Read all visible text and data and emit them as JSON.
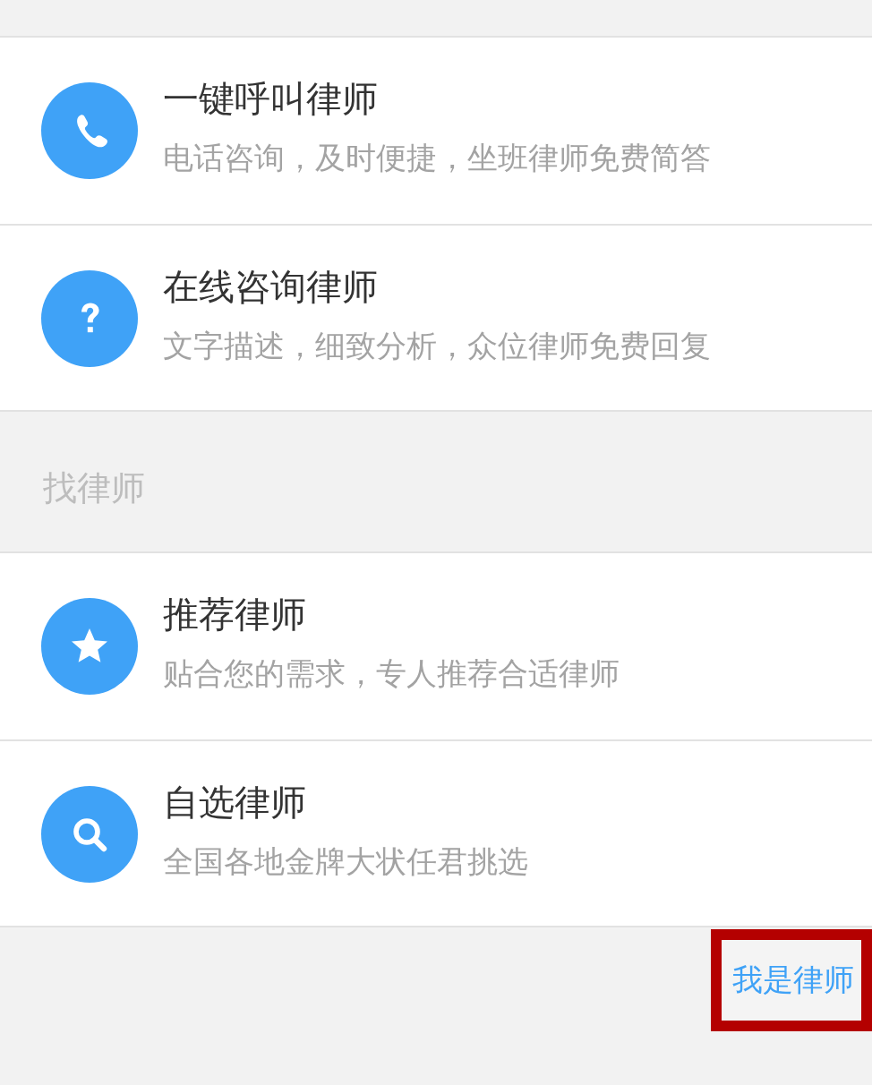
{
  "groups": [
    {
      "items": [
        {
          "kind": "phone",
          "title": "一键呼叫律师",
          "subtitle": "电话咨询，及时便捷，坐班律师免费简答"
        },
        {
          "kind": "question",
          "title": "在线咨询律师",
          "subtitle": "文字描述，细致分析，众位律师免费回复"
        }
      ]
    },
    {
      "header": "找律师",
      "items": [
        {
          "kind": "star",
          "title": "推荐律师",
          "subtitle": "贴合您的需求，专人推荐合适律师"
        },
        {
          "kind": "search",
          "title": "自选律师",
          "subtitle": "全国各地金牌大状任君挑选"
        }
      ]
    }
  ],
  "lawyer_link": {
    "label": "我是律师",
    "highlighted": true
  }
}
